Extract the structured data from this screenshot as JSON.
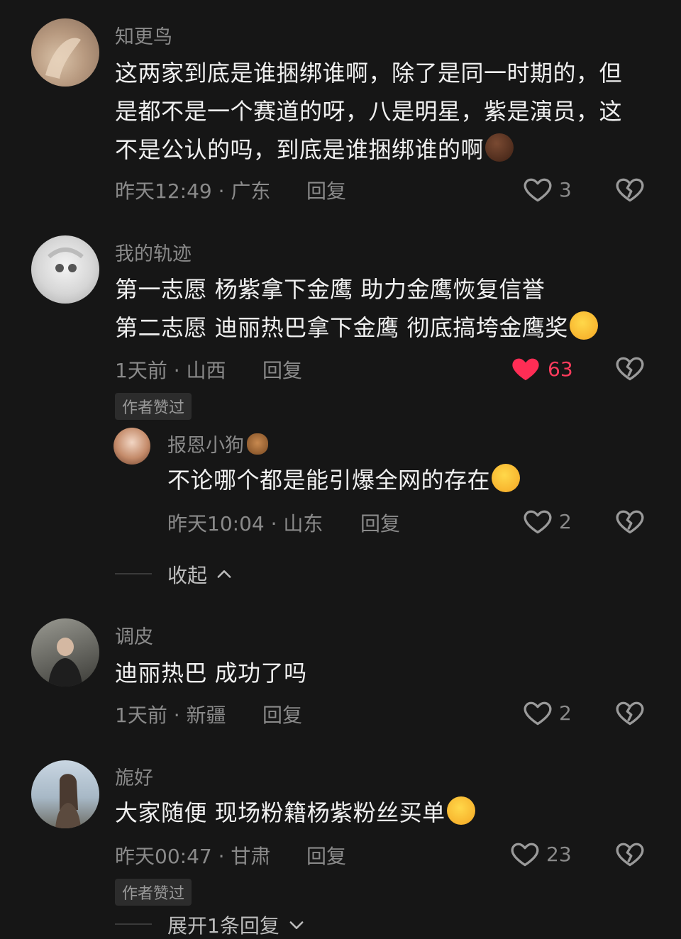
{
  "comments": [
    {
      "username": "知更鸟",
      "lines": [
        "这两家到底是谁捆绑谁啊，除了是同一时期的，但",
        "是都不是一个赛道的呀，八是明星，紫是演员，这",
        "不是公认的吗，到底是谁捆绑谁的啊"
      ],
      "time_location": "昨天12:49 · 广东",
      "reply_label": "回复",
      "likes": "3",
      "liked": false
    },
    {
      "username": "我的轨迹",
      "lines": [
        "第一志愿 杨紫拿下金鹰 助力金鹰恢复信誉",
        "第二志愿 迪丽热巴拿下金鹰 彻底搞垮金鹰奖"
      ],
      "time_location": "1天前 · 山西",
      "reply_label": "回复",
      "likes": "63",
      "liked": true,
      "badge": "作者赞过",
      "replies": [
        {
          "username": "报恩小狗",
          "text": "不论哪个都是能引爆全网的存在",
          "time_location": "昨天10:04 · 山东",
          "reply_label": "回复",
          "likes": "2"
        }
      ],
      "collapse_label": "收起"
    },
    {
      "username": "调皮",
      "lines": [
        "迪丽热巴 成功了吗"
      ],
      "time_location": "1天前 · 新疆",
      "reply_label": "回复",
      "likes": "2",
      "liked": false
    },
    {
      "username": "旎好",
      "lines": [
        "大家随便 现场粉籍杨紫粉丝买单"
      ],
      "time_location": "昨天00:47 · 甘肃",
      "reply_label": "回复",
      "likes": "23",
      "liked": false,
      "badge": "作者赞过",
      "expand_label": "展开1条回复"
    }
  ],
  "icons": {
    "like": "heart-outline-icon",
    "liked": "heart-filled-icon",
    "dislike": "broken-heart-icon",
    "collapse": "chevron-up-icon",
    "expand": "chevron-down-icon"
  },
  "colors": {
    "background": "#161616",
    "liked": "#ff3b5c",
    "muted": "#8a8a8a"
  }
}
